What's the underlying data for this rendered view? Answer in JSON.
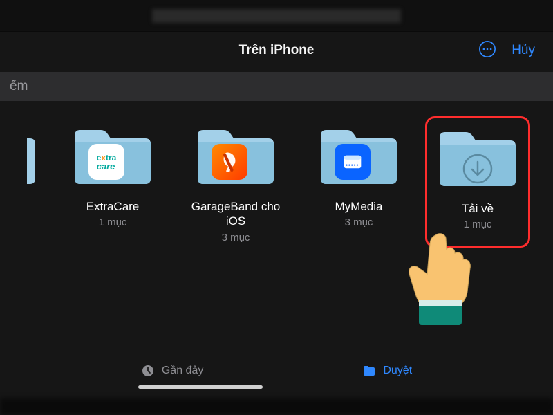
{
  "header": {
    "title": "Trên iPhone",
    "cancel": "Hủy"
  },
  "search": {
    "placeholder_fragment": "ếm"
  },
  "folders": [
    {
      "name": "ExtraCare",
      "subtitle": "1 mục",
      "app": "extracare"
    },
    {
      "name": "GarageBand cho iOS",
      "subtitle": "3 mục",
      "app": "garageband"
    },
    {
      "name": "MyMedia",
      "subtitle": "3 mục",
      "app": "mymedia"
    },
    {
      "name": "Tải về",
      "subtitle": "1 mục",
      "app": "downloads",
      "highlighted": true
    }
  ],
  "tabs": {
    "recent": "Gần đây",
    "browse": "Duyệt"
  },
  "colors": {
    "accent": "#2f88ff",
    "folder_light": "#a3d0e9",
    "folder_dark": "#7bb8d6",
    "highlight": "#ff2d2d",
    "text_secondary": "#8e8e93"
  }
}
